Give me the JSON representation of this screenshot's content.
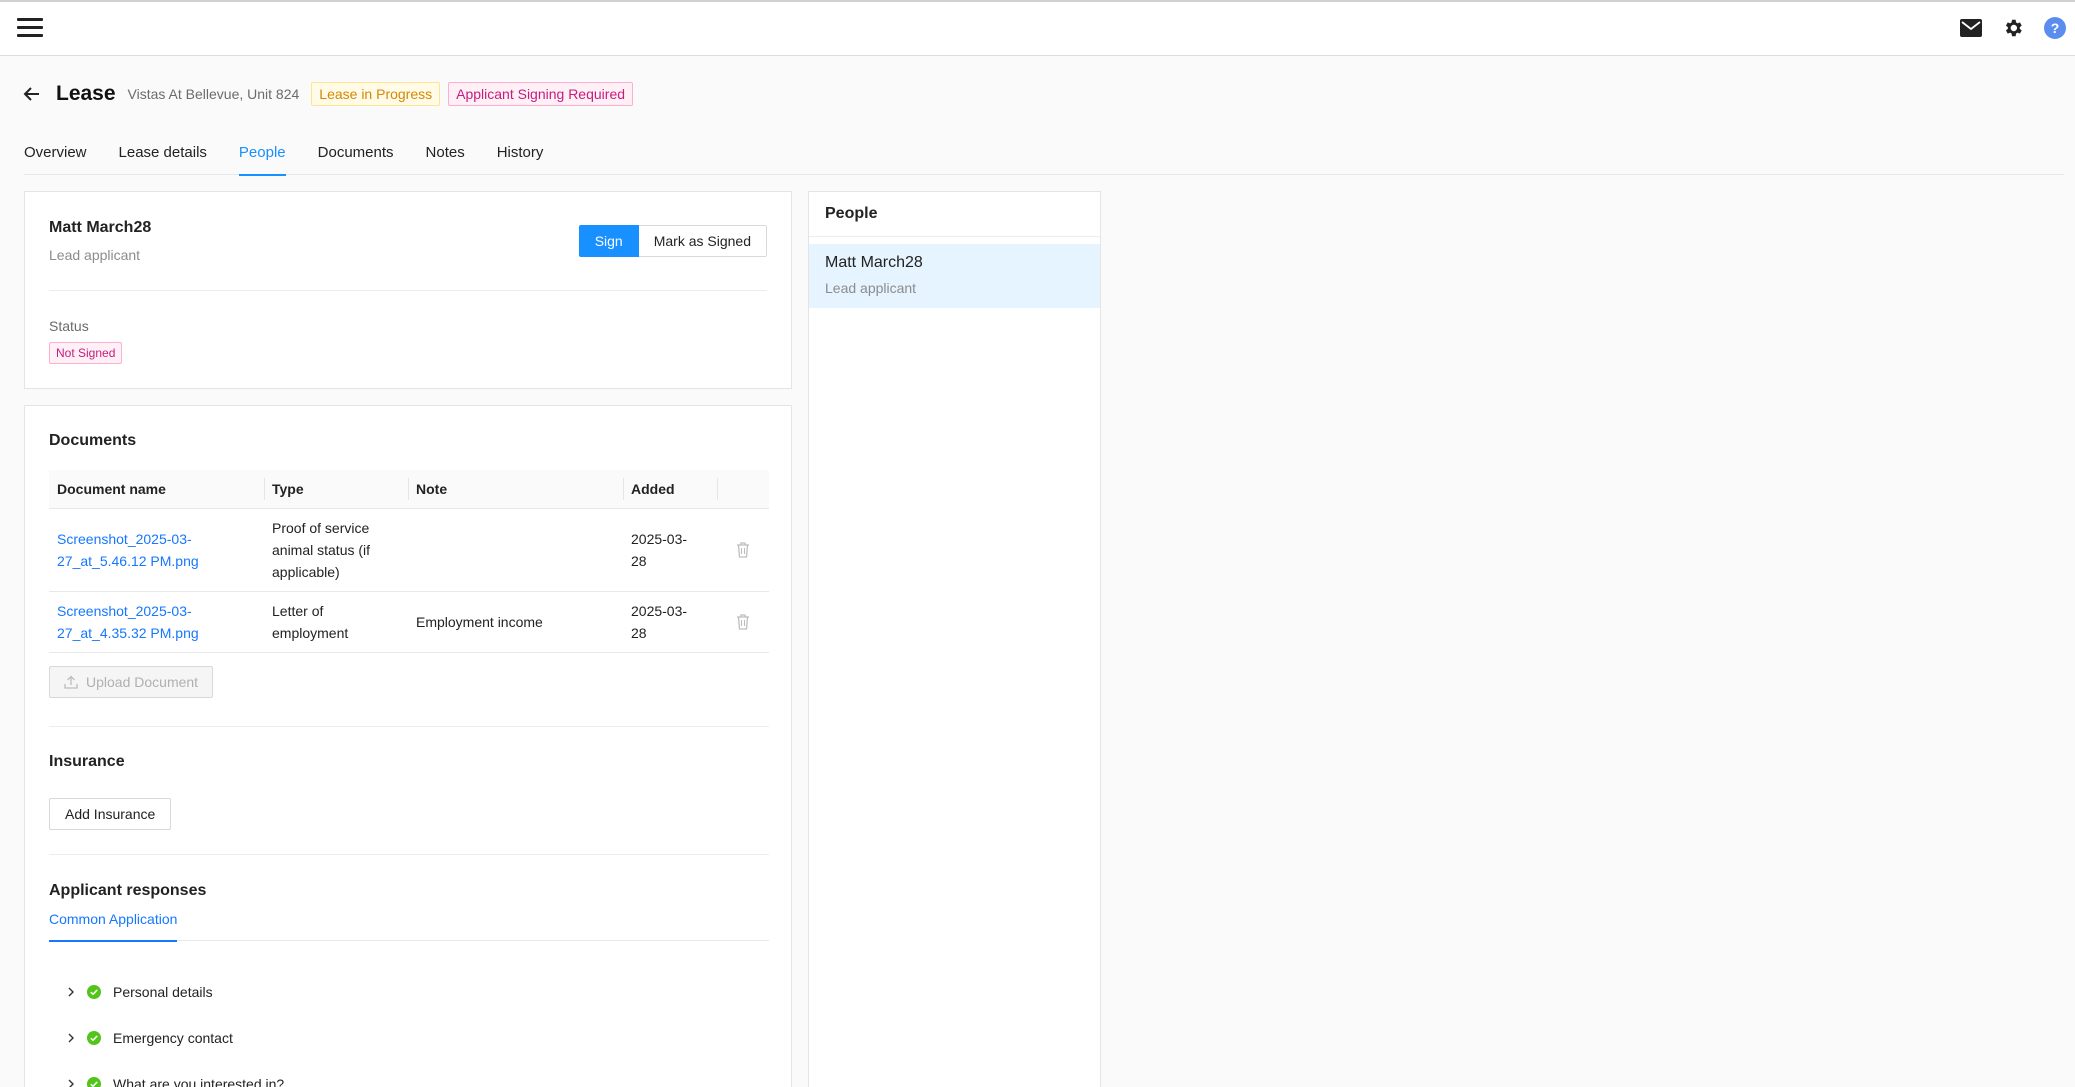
{
  "topbar": {
    "icons": [
      "menu-icon",
      "mail-icon",
      "gear-icon",
      "help-icon"
    ]
  },
  "header": {
    "title": "Lease",
    "subtitle": "Vistas At Bellevue, Unit 824",
    "badges": [
      "Lease in Progress",
      "Applicant Signing Required"
    ]
  },
  "tabs": [
    "Overview",
    "Lease details",
    "People",
    "Documents",
    "Notes",
    "History"
  ],
  "active_tab": "People",
  "person": {
    "name": "Matt March28",
    "role": "Lead applicant",
    "sign_label": "Sign",
    "mark_signed_label": "Mark as Signed",
    "status_label": "Status",
    "status_value": "Not Signed"
  },
  "documents": {
    "title": "Documents",
    "columns": [
      "Document name",
      "Type",
      "Note",
      "Added"
    ],
    "rows": [
      {
        "name_line1": "Screenshot_2025-03-",
        "name_line2": "27_at_5.46.12 PM.png",
        "type": "Proof of service animal status (if applicable)",
        "note": "",
        "added_line1": "2025-03-",
        "added_line2": "28"
      },
      {
        "name_line1": "Screenshot_2025-03-",
        "name_line2": "27_at_4.35.32 PM.png",
        "type": "Letter of employment",
        "note": "Employment income",
        "added_line1": "2025-03-",
        "added_line2": "28"
      }
    ],
    "upload_label": "Upload Document"
  },
  "insurance": {
    "title": "Insurance",
    "add_label": "Add Insurance"
  },
  "applicant_responses": {
    "title": "Applicant responses",
    "subtab": "Common Application",
    "items": [
      "Personal details",
      "Emergency contact",
      "What are you interested in?"
    ]
  },
  "people_panel": {
    "title": "People",
    "items": [
      {
        "name": "Matt March28",
        "role": "Lead applicant"
      }
    ]
  },
  "colors": {
    "accent": "#1890ff",
    "amber_badge": "#d48806",
    "pink_badge": "#c41d7f",
    "success": "#52c41a",
    "selected_bg": "#e6f4ff"
  }
}
